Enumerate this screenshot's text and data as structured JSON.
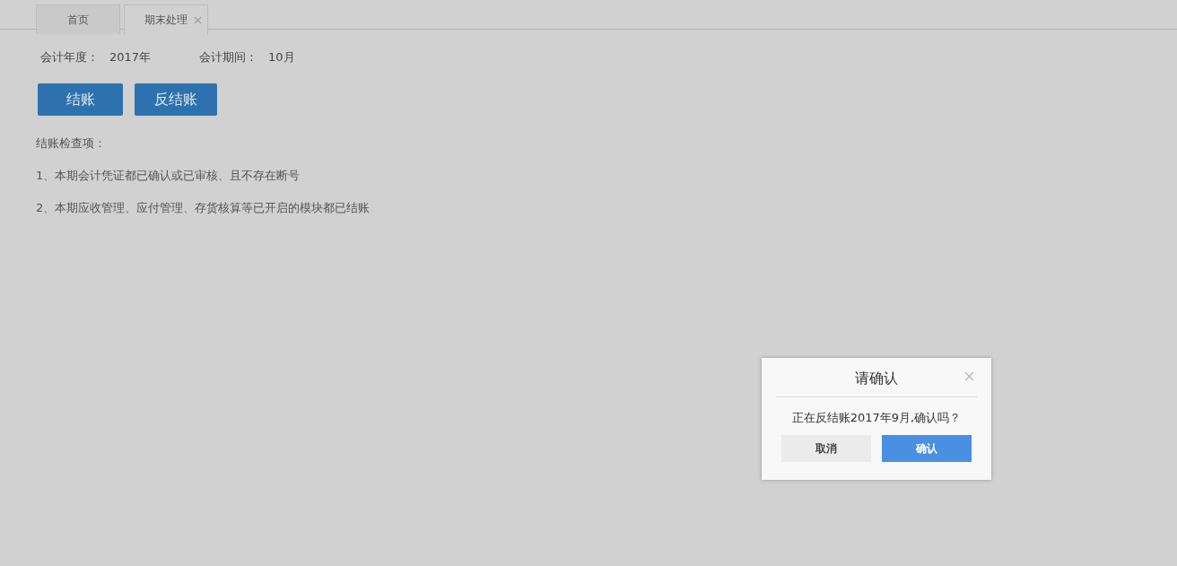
{
  "tabs": [
    {
      "label": "首页",
      "selected": false,
      "closable": false
    },
    {
      "label": "期末处理",
      "selected": true,
      "closable": true
    }
  ],
  "fields": [
    {
      "label": "会计年度：",
      "value": "2017年"
    },
    {
      "label": "会计期间：",
      "value": "10月"
    }
  ],
  "actions": [
    "结账",
    "反结账"
  ],
  "checklist": {
    "title": "结账检查项：",
    "items": [
      "1、本期会计凭证都已确认或已审核、且不存在断号",
      "2、本期应收管理、应付管理、存货核算等已开启的模块都已结账"
    ]
  },
  "dialog": {
    "title": "请确认",
    "message": "正在反结账2017年9月,确认吗？",
    "buttons": [
      {
        "label": "取消",
        "kind": "secondary"
      },
      {
        "label": "确认",
        "kind": "primary"
      }
    ]
  }
}
